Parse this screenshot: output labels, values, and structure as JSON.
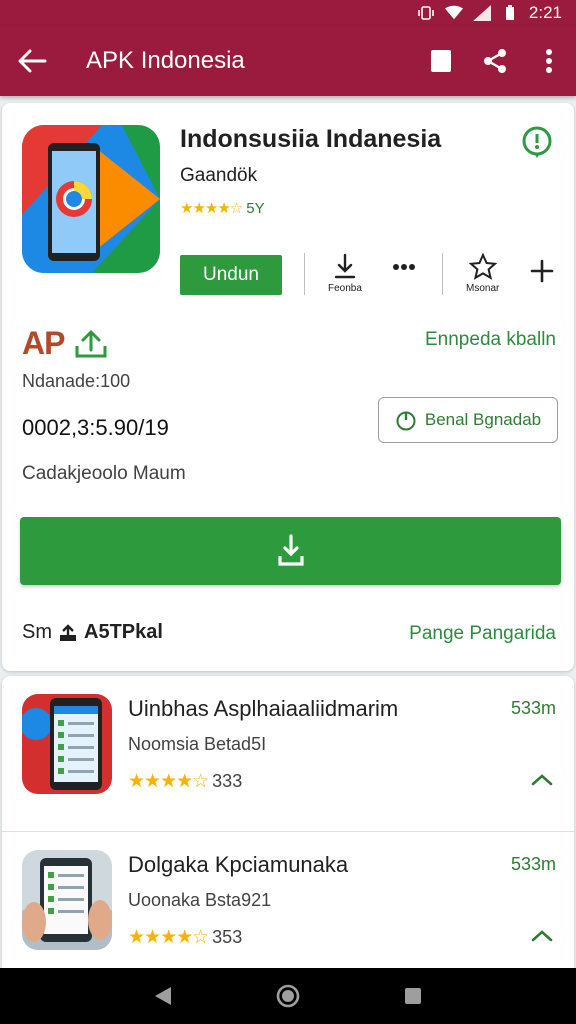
{
  "status_bar": {
    "time": "2:21"
  },
  "app_bar": {
    "title": "APK Indonesia"
  },
  "app": {
    "name": "Indonsusiia Indanesia",
    "developer": "Gaandök",
    "rating_text": "5Y",
    "install_label": "Undun",
    "actions": [
      {
        "icon": "download-icon",
        "label": "Feonba"
      },
      {
        "icon": "more-dots-icon",
        "label": ""
      },
      {
        "icon": "star-icon",
        "label": "Msonar"
      },
      {
        "icon": "plus-icon",
        "label": ""
      }
    ],
    "apk_logo_text": "AP",
    "link_right": "Ennpeda kballn",
    "downloads": "Ndanade:100",
    "version": "0002,3:5.90/19",
    "outline_button": "Benal Bgnadab",
    "category": "Cadakjeoolo Maum",
    "size_prefix": "Sm",
    "size_value": "A5TPkal",
    "size_link": "Pange Pangarida"
  },
  "related": [
    {
      "name": "Uinbhas Asplhaiaaliidmarim",
      "subtitle": "Noomsia Betad5I",
      "rating_count": "333",
      "size": "533m"
    },
    {
      "name": "Dolgaka Kpciamunaka",
      "subtitle": "Uoonaka Bsta921",
      "rating_count": "353",
      "size": "533m"
    }
  ],
  "colors": {
    "header": "#9a1b3d",
    "accent_green": "#2e9a3e",
    "star": "#f4b400"
  }
}
